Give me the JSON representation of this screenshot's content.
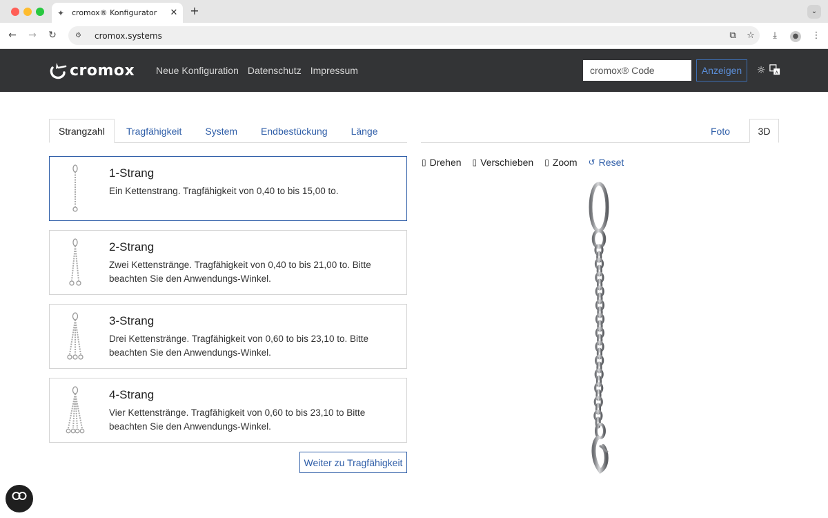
{
  "browser": {
    "tab_title": "cromox® Konfigurator",
    "tab_close": "✕",
    "new_tab": "+",
    "url": "cromox.systems"
  },
  "header": {
    "logo_text": "cromox",
    "nav": [
      "Neue Konfiguration",
      "Datenschutz",
      "Impressum"
    ],
    "code_placeholder": "cromox® Code",
    "show_button": "Anzeigen"
  },
  "config_tabs": [
    {
      "label": "Strangzahl",
      "active": true
    },
    {
      "label": "Tragfähigkeit",
      "active": false
    },
    {
      "label": "System",
      "active": false
    },
    {
      "label": "Endbestückung",
      "active": false
    },
    {
      "label": "Länge",
      "active": false
    }
  ],
  "strands": [
    {
      "title": "1-Strang",
      "desc": "Ein Kettenstrang. Tragfähigkeit von 0,40 to bis 15,00 to.",
      "selected": true
    },
    {
      "title": "2-Strang",
      "desc": "Zwei Kettenstränge. Tragfähigkeit von 0,40 to bis 21,00 to. Bitte beachten Sie den Anwendungs-Winkel.",
      "selected": false
    },
    {
      "title": "3-Strang",
      "desc": "Drei Kettenstränge. Tragfähigkeit von 0,60 to bis 23,10 to. Bitte beachten Sie den Anwendungs-Winkel.",
      "selected": false
    },
    {
      "title": "4-Strang",
      "desc": "Vier Kettenstränge. Tragfähigkeit von 0,60 to bis 23,10 to Bitte beachten Sie den Anwendungs-Winkel.",
      "selected": false
    }
  ],
  "next_button": "Weiter zu Tragfähigkeit",
  "view_tabs": {
    "foto": "Foto",
    "threed": "3D",
    "active": "3D"
  },
  "viewer_controls": {
    "rotate": "Drehen",
    "pan": "Verschieben",
    "zoom": "Zoom",
    "reset": "Reset"
  },
  "colors": {
    "header_bg": "#333436",
    "link": "#2f5ea8",
    "accent": "#3d6fb5"
  }
}
